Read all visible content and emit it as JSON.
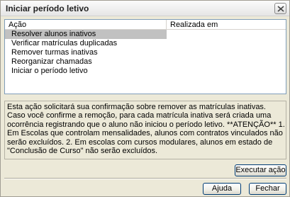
{
  "window": {
    "title": "Iniciar período letivo"
  },
  "list": {
    "columns": [
      "Ação",
      "Realizada em"
    ],
    "rows": [
      {
        "action": "Resolver alunos inativos",
        "done_at": ""
      },
      {
        "action": "Verificar matrículas duplicadas",
        "done_at": ""
      },
      {
        "action": "Remover turmas inativas",
        "done_at": ""
      },
      {
        "action": "Reorganizar chamadas",
        "done_at": ""
      },
      {
        "action": "Iniciar o período letivo",
        "done_at": ""
      }
    ],
    "selected_index": 0
  },
  "info": {
    "text": "Esta ação solicitará sua confirmação sobre remover as matrículas inativas.  Caso você confirme a remoção, para cada matrícula inativa será criada uma ocorrência registrando que o aluno não iniciou o período letivo.   **ATENÇÃO**  1. Em Escolas que controlam mensalidades, alunos com contratos vinculados não serão excluídos.  2. Em escolas com cursos modulares, alunos em estado de \"Conclusão de Curso\" não serão excluídos."
  },
  "buttons": {
    "execute": "Executar ação",
    "help": "Ajuda",
    "close": "Fechar"
  },
  "colors": {
    "selection": "#c1c1c1",
    "dialog_bg": "#ece9d8",
    "button_border": "#003c74"
  },
  "icons": {
    "close": "close-icon"
  }
}
